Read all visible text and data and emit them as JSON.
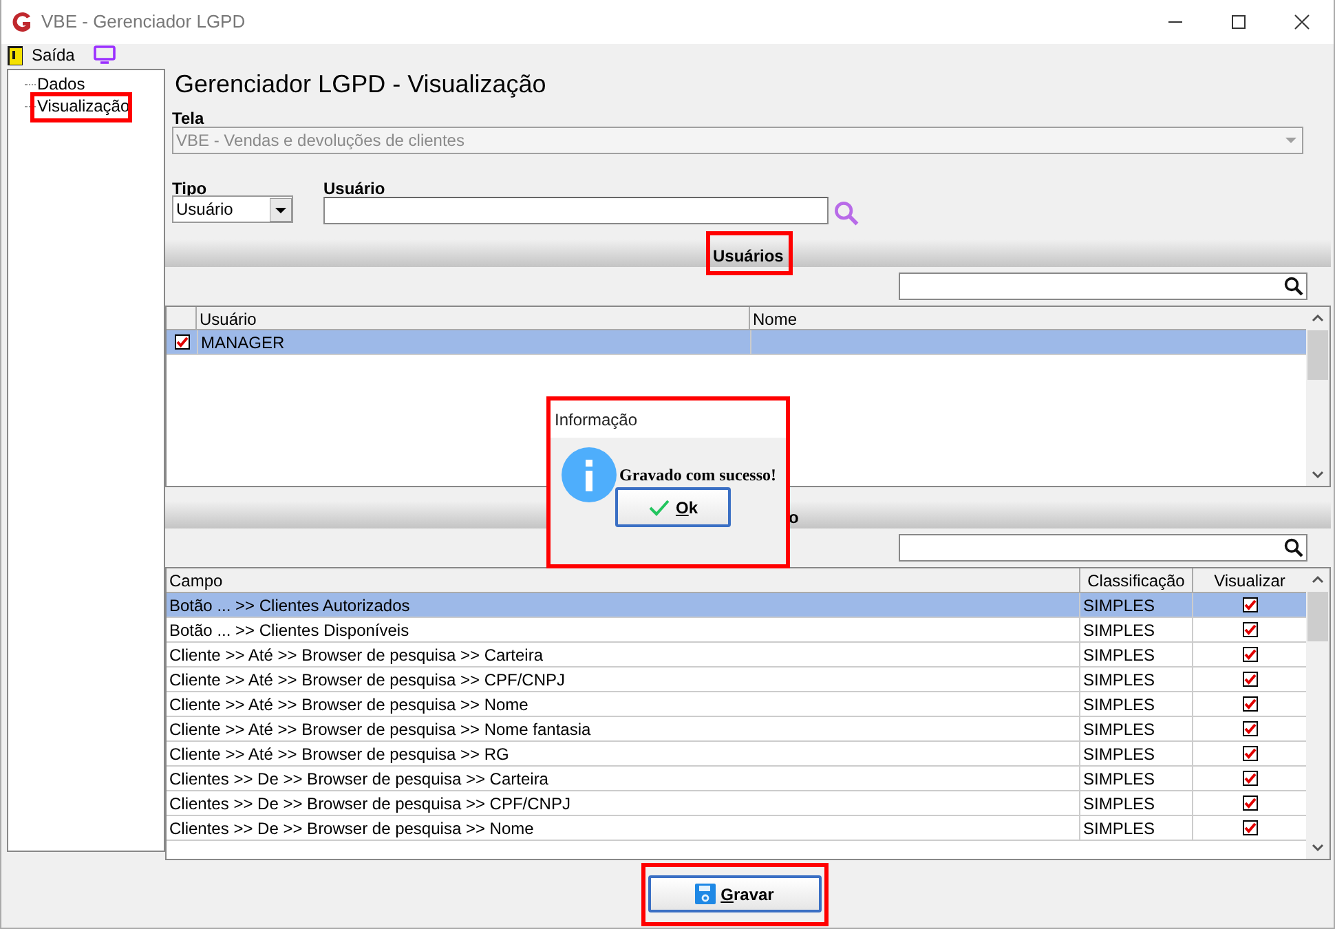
{
  "window": {
    "title": "VBE - Gerenciador LGPD"
  },
  "toolbar": [
    {
      "kind": "exit",
      "label": "Saída"
    },
    {
      "kind": "screen"
    }
  ],
  "tree": [
    {
      "label": "Dados",
      "annotated": false
    },
    {
      "label": "Visualização",
      "annotated": true
    }
  ],
  "heading": "Gerenciador LGPD - Visualização",
  "tela": {
    "label": "Tela",
    "value": "VBE - Vendas e devoluções de clientes",
    "disabled": true
  },
  "tipo": {
    "label": "Tipo",
    "value": "Usuário"
  },
  "usuario": {
    "label": "Usuário"
  },
  "users_section": {
    "title": "Usuários",
    "annotated": true,
    "columns": [
      "Usuário",
      "Nome"
    ],
    "rows": [
      {
        "checked": true,
        "usuario": "MANAGER",
        "selected": true
      }
    ]
  },
  "fields_section": {
    "title": "o",
    "columns": [
      "Campo",
      "Classificação",
      "Visualizar"
    ],
    "rows": [
      {
        "campo": "Botão ... >> Clientes Autorizados",
        "classificacao": "SIMPLES",
        "visualizar": true,
        "selected": true
      },
      {
        "campo": "Botão ... >> Clientes Disponíveis",
        "classificacao": "SIMPLES",
        "visualizar": true,
        "selected": false
      },
      {
        "campo": "Cliente >> Até >> Browser de pesquisa >> Carteira",
        "classificacao": "SIMPLES",
        "visualizar": true,
        "selected": false
      },
      {
        "campo": "Cliente >> Até >> Browser de pesquisa >> CPF/CNPJ",
        "classificacao": "SIMPLES",
        "visualizar": true,
        "selected": false
      },
      {
        "campo": "Cliente >> Até >> Browser de pesquisa >> Nome",
        "classificacao": "SIMPLES",
        "visualizar": true,
        "selected": false
      },
      {
        "campo": "Cliente >> Até >> Browser de pesquisa >> Nome fantasia",
        "classificacao": "SIMPLES",
        "visualizar": true,
        "selected": false
      },
      {
        "campo": "Cliente >> Até >> Browser de pesquisa >> RG",
        "classificacao": "SIMPLES",
        "visualizar": true,
        "selected": false
      },
      {
        "campo": "Clientes >> De >> Browser de pesquisa >> Carteira",
        "classificacao": "SIMPLES",
        "visualizar": true,
        "selected": false
      },
      {
        "campo": "Clientes >> De >> Browser de pesquisa >> CPF/CNPJ",
        "classificacao": "SIMPLES",
        "visualizar": true,
        "selected": false
      },
      {
        "campo": "Clientes >> De >> Browser de pesquisa >> Nome",
        "classificacao": "SIMPLES",
        "visualizar": true,
        "selected": false
      }
    ]
  },
  "dialog": {
    "title": "Informação",
    "message": "Gravado com sucesso!",
    "button": "Ok",
    "annotated": true
  },
  "save_button": {
    "label": "Gravar",
    "annotated": true
  }
}
